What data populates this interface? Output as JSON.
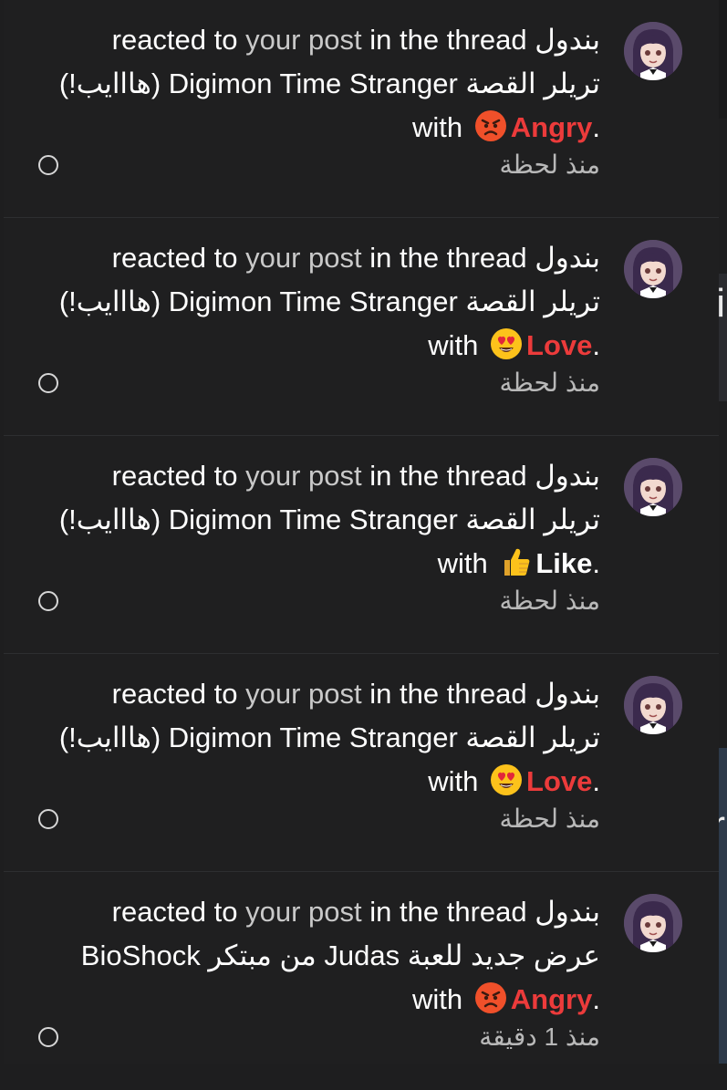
{
  "notifications": [
    {
      "username": "بندول",
      "action": "reacted to",
      "post_link": "your post",
      "in_thread": "in the thread",
      "thread_title": "تريلر القصة Digimon Time Stranger (هااايب!)",
      "with_word": "with",
      "reaction": "Angry",
      "reaction_icon": "angry-face-emoji",
      "period": ".",
      "time": "منذ لحظة"
    },
    {
      "username": "بندول",
      "action": "reacted to",
      "post_link": "your post",
      "in_thread": "in the thread",
      "thread_title": "تريلر القصة Digimon Time Stranger (هااايب!)",
      "with_word": "with",
      "reaction": "Love",
      "reaction_icon": "heart-eyes-emoji",
      "period": ".",
      "time": "منذ لحظة"
    },
    {
      "username": "بندول",
      "action": "reacted to",
      "post_link": "your post",
      "in_thread": "in the thread",
      "thread_title": "تريلر القصة Digimon Time Stranger (هااايب!)",
      "with_word": "with",
      "reaction": "Like",
      "reaction_icon": "thumbs-up-emoji",
      "period": ".",
      "time": "منذ لحظة"
    },
    {
      "username": "بندول",
      "action": "reacted to",
      "post_link": "your post",
      "in_thread": "in the thread",
      "thread_title": "تريلر القصة Digimon Time Stranger (هااايب!)",
      "with_word": "with",
      "reaction": "Love",
      "reaction_icon": "heart-eyes-emoji",
      "period": ".",
      "time": "منذ لحظة"
    },
    {
      "username": "بندول",
      "action": "reacted to",
      "post_link": "your post",
      "in_thread": "in the thread",
      "thread_title": "عرض جديد للعبة Judas من مبتكر BioShock",
      "with_word": "with",
      "reaction": "Angry",
      "reaction_icon": "angry-face-emoji",
      "period": ".",
      "time": "منذ 1 دقيقة"
    }
  ],
  "background_glyphs": [
    "i",
    "r"
  ],
  "colors": {
    "panel": "#1f1f20",
    "reaction_red": "#ec3b3b",
    "link_gray": "#c9c9c9"
  }
}
